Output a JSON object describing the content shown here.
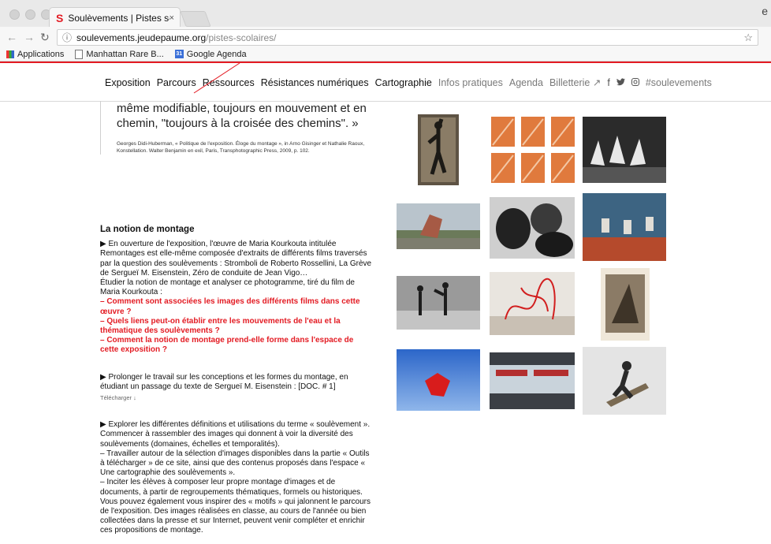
{
  "browser": {
    "tab_title": "Soulèvements | Pistes scolaire",
    "tab_close": "×",
    "url_host": "soulevements.jeudepaume.org",
    "url_path": "/pistes-scolaires/",
    "bookmarks": [
      "Applications",
      "Manhattan Rare B...",
      "Google Agenda"
    ]
  },
  "nav": {
    "items": [
      "Exposition",
      "Parcours",
      "Ressources",
      "Résistances numériques",
      "Cartographie"
    ],
    "secondary": [
      "Infos pratiques",
      "Agenda",
      "Billetterie ↗"
    ],
    "hashtag": "#soulevements"
  },
  "quote": {
    "text": "même modifiable, toujours en mouvement et en chemin, \"toujours à la croisée des chemins\". »",
    "citation": "Georges Didi-Huberman, « Politique de l'exposition. Éloge du montage », in Arno Gisinger et Nathalie Raoux, Konstellation. Walter Benjamin en exil, Paris, Transphotographic Press, 2009, p. 102."
  },
  "section": {
    "title": "La notion de montage",
    "p1": "▶ En ouverture de l'exposition, l'œuvre de Maria Kourkouta intitulée Remontages est elle-même composée d'extraits de différents films traversés par la question des soulèvements : Stromboli de Roberto Rossellini, La Grève de Sergueï M. Eisenstein, Zéro de conduite de Jean Vigo…",
    "p2": "Étudier la notion de montage et analyser ce photogramme, tiré du film de Maria Kourkouta :",
    "questions": [
      "– Comment sont associées les images des différents films dans cette œuvre ?",
      "– Quels liens peut-on établir entre les mouvements de l'eau et la thématique des soulèvements ?",
      "– Comment la notion de montage prend-elle forme dans l'espace de cette exposition ?"
    ],
    "p3": "▶ Prolonger le travail sur les conceptions et les formes du montage, en étudiant un passage du texte de Sergueï M. Eisenstein : [DOC. # 1]",
    "download": "Télécharger ↓",
    "p4": "▶ Explorer les différentes définitions et utilisations du terme « soulèvement ». Commencer à rassembler des images qui donnent à voir la diversité des soulèvements (domaines, échelles et temporalités).",
    "p5": "– Travailler autour de la sélection d'images disponibles dans la partie « Outils à télécharger » de ce site, ainsi que des contenus proposés dans l'espace « Une cartographie des soulèvements ».",
    "p6": "– Inciter les élèves à composer leur propre montage d'images et de documents, à partir de regroupements thématiques, formels ou historiques. Vous pouvez également vous inspirer des « motifs » qui jalonnent le parcours de l'exposition. Des images réalisées en classe, au cours de l'année ou bien collectées dans la presse et sur Internet, peuvent venir compléter et enrichir ces propositions de montage."
  },
  "colors": {
    "accent": "#e31b23"
  }
}
